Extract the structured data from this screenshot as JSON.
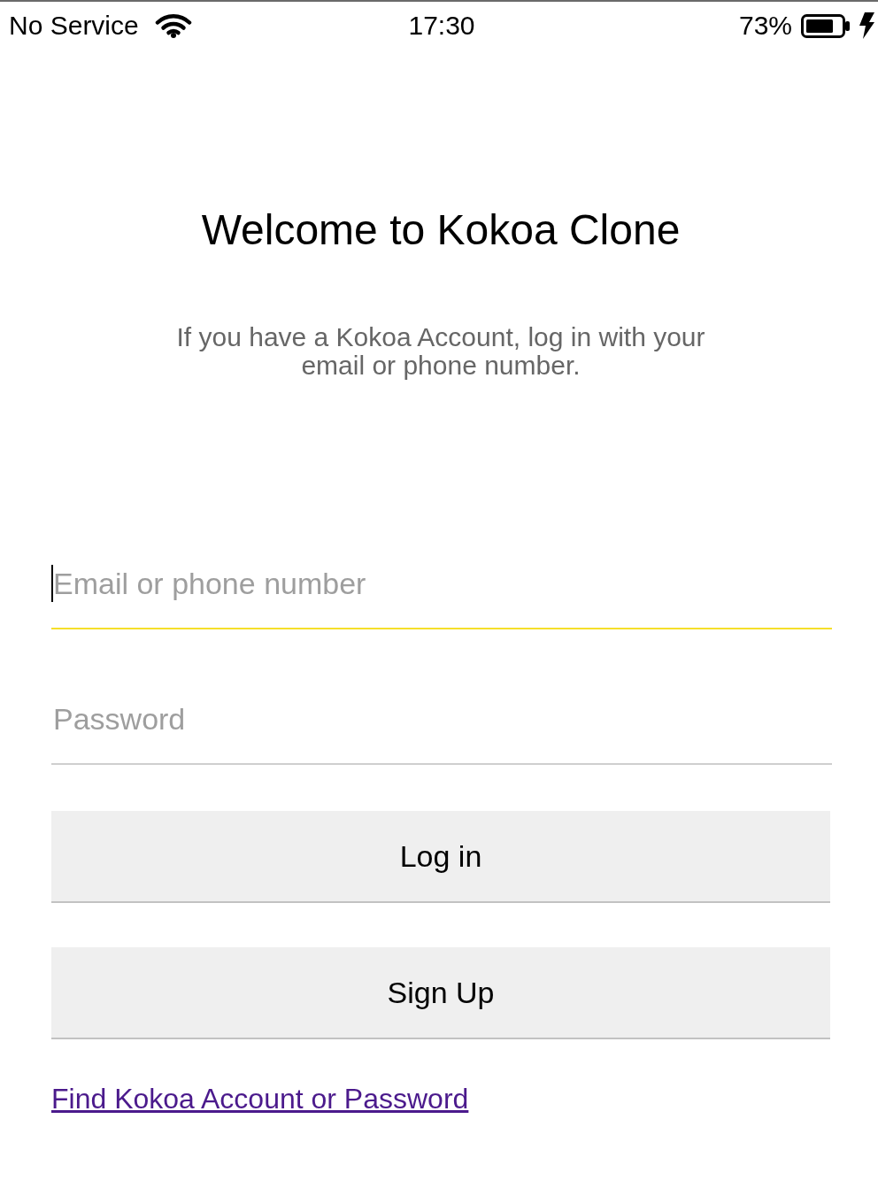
{
  "status_bar": {
    "carrier": "No Service",
    "time": "17:30",
    "battery_percent": "73%",
    "charging": true
  },
  "header": {
    "title": "Welcome to Kokoa Clone",
    "subtitle": "If you have a Kokoa Account, log in with your email or phone number."
  },
  "form": {
    "fields": [
      {
        "placeholder": "Email or phone number",
        "focused": true
      },
      {
        "placeholder": "Password",
        "focused": false
      }
    ],
    "buttons": [
      {
        "label": "Log in"
      },
      {
        "label": "Sign Up"
      }
    ],
    "link": {
      "label": "Find Kokoa Account or Password",
      "visited": true
    }
  }
}
